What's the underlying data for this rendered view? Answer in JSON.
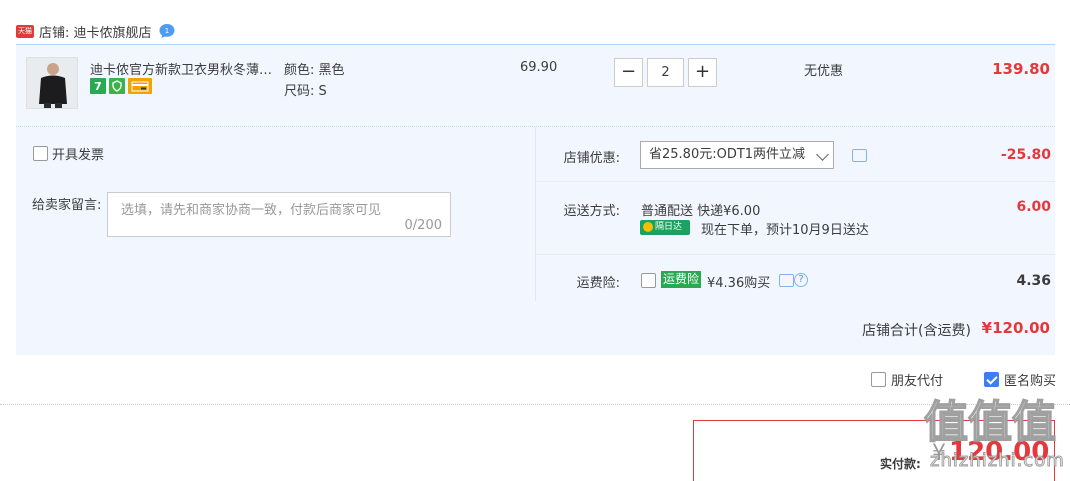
{
  "store": {
    "badge_text": "天猫",
    "label": "店铺: 迪卡侬旗舰店"
  },
  "item": {
    "title": "迪卡侬官方新款卫衣男秋冬薄款...",
    "badge_7": "7",
    "color": "颜色: 黑色",
    "size": "尺码: S",
    "unit_price": "69.90",
    "quantity": "2",
    "minus": "−",
    "plus": "+",
    "discount": "无优惠",
    "total": "139.80"
  },
  "invoice": {
    "label": "开具发票"
  },
  "message": {
    "label": "给卖家留言:",
    "placeholder": "选填，请先和商家协商一致，付款后商家可见",
    "count": "0/200"
  },
  "coupon": {
    "label": "店铺优惠:",
    "selected": "省25.80元:ODT1两件立减",
    "amount": "-25.80"
  },
  "shipping": {
    "label": "运送方式:",
    "method": "普通配送 快递¥6.00",
    "badge": "隔日达",
    "eta": "现在下单，预计10月9日送达",
    "amount": "6.00"
  },
  "insurance": {
    "label": "运费险:",
    "badge": "运费险",
    "price": "¥4.36购买",
    "help": "?",
    "amount": "4.36"
  },
  "store_total": {
    "label": "店铺合计(含运费)",
    "value": "¥120.00"
  },
  "options": {
    "friend_pay": "朋友代付",
    "anonymous": "匿名购买"
  },
  "payment": {
    "label": "实付款:",
    "currency": "¥",
    "value": "120.00"
  },
  "watermark": {
    "glyphs": [
      "值",
      "值",
      "值"
    ],
    "url": "zhizhizhi.com"
  },
  "colors": {
    "accent_red": "#e4393c",
    "panel_bg": "#f2f7ff",
    "border_blue": "#b2d1ff",
    "badge_green": "#2aa952",
    "checkbox_blue": "#3d7ef2"
  },
  "icons": {
    "store": "tmall-icon",
    "chat": "chat-bubble-icon",
    "comment": "comment-icon",
    "help": "help-icon",
    "dropdown": "chevron-down-icon"
  }
}
